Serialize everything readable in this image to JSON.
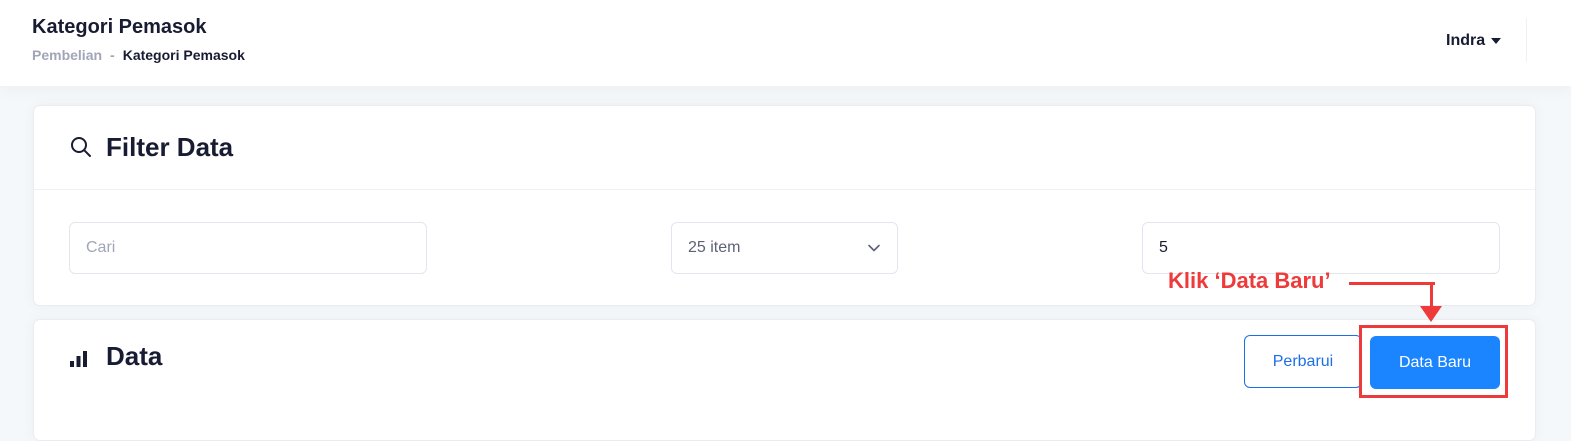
{
  "header": {
    "title": "Kategori Pemasok",
    "breadcrumb": {
      "parent": "Pembelian",
      "separator": "-",
      "current": "Kategori Pemasok"
    },
    "user": {
      "name": "Indra",
      "icon": "caret-down-icon"
    }
  },
  "filter": {
    "title": "Filter Data",
    "icon": "search-icon",
    "search_placeholder": "Cari",
    "per_page_value": "25 item",
    "per_page_icon": "chevron-down-icon",
    "page_value": "5"
  },
  "data_section": {
    "title": "Data",
    "icon": "bar-chart-icon",
    "refresh_label": "Perbarui",
    "new_label": "Data Baru"
  },
  "annotation": {
    "text": "Klik ‘Data Baru’",
    "color": "#ee3a3a"
  },
  "colors": {
    "primary": "#1b84ff",
    "outline": "#1d6fe8",
    "heading": "#181c32",
    "muted": "#a1a5b7"
  }
}
